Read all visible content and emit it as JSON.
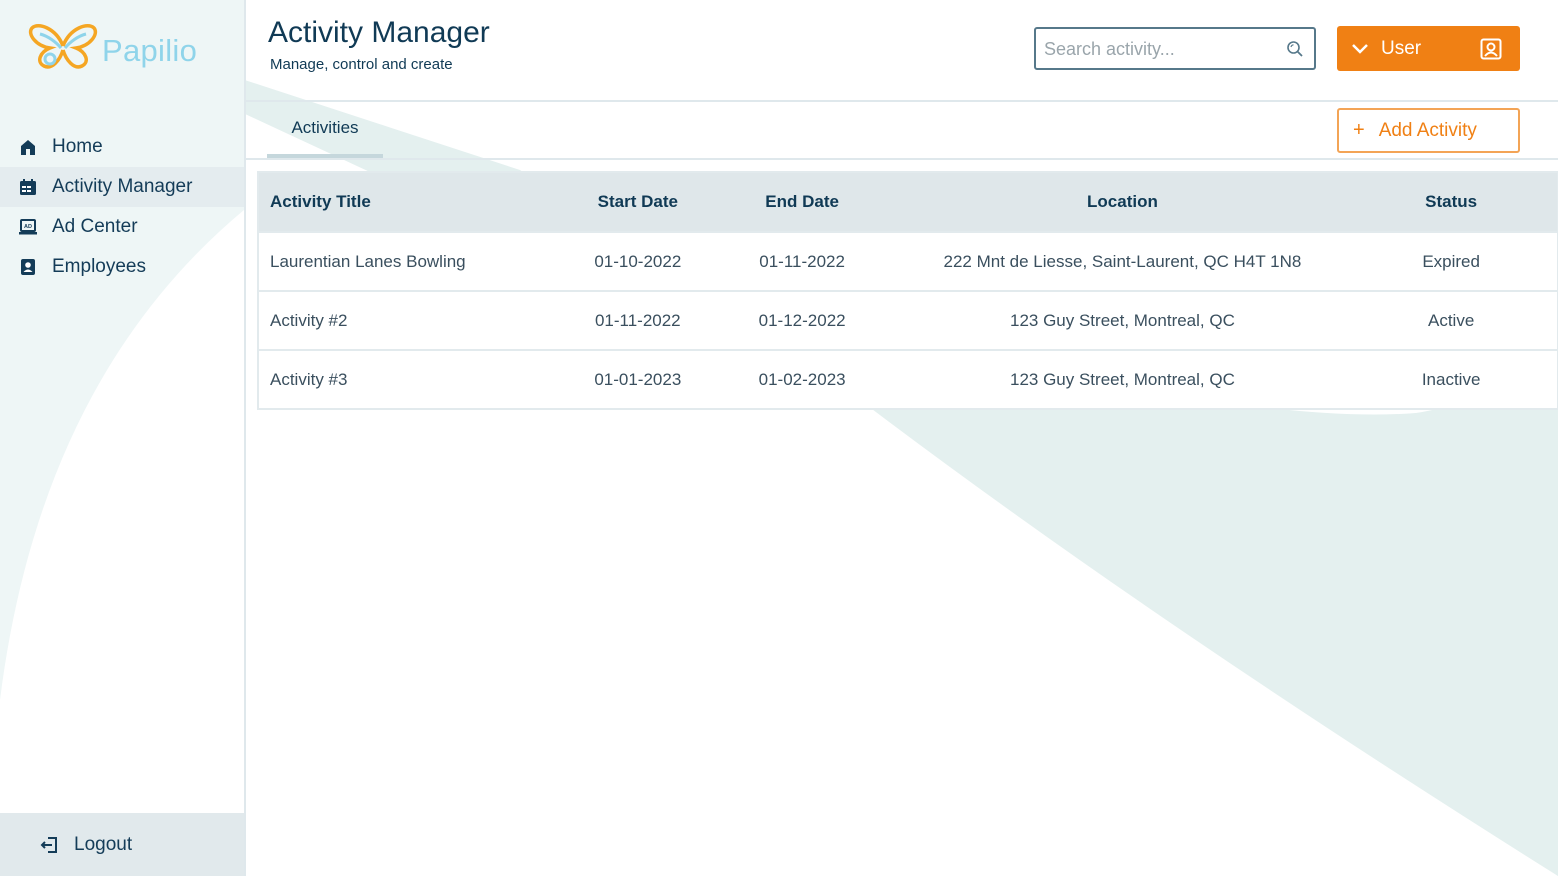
{
  "brand": {
    "name": "Papilio"
  },
  "sidebar": {
    "items": [
      {
        "label": "Home",
        "icon": "home-icon"
      },
      {
        "label": "Activity Manager",
        "icon": "calendar-icon",
        "active": true
      },
      {
        "label": "Ad Center",
        "icon": "ad-icon"
      },
      {
        "label": "Employees",
        "icon": "employee-badge-icon"
      }
    ],
    "logout_label": "Logout"
  },
  "header": {
    "title": "Activity Manager",
    "subtitle": "Manage, control and create",
    "search_placeholder": "Search activity...",
    "user_label": "User"
  },
  "tabs": [
    {
      "label": "Activities",
      "active": true
    }
  ],
  "actions": {
    "add_label": "Add Activity"
  },
  "table": {
    "columns": [
      "Activity Title",
      "Start Date",
      "End Date",
      "Location",
      "Status"
    ],
    "rows": [
      [
        "Laurentian Lanes Bowling",
        "01-10-2022",
        "01-11-2022",
        "222 Mnt de Liesse, Saint-Laurent, QC H4T 1N8",
        "Expired"
      ],
      [
        "Activity #2",
        "01-11-2022",
        "01-12-2022",
        "123 Guy Street, Montreal, QC",
        "Active"
      ],
      [
        "Activity #3",
        "01-01-2023",
        "01-02-2023",
        "123 Guy Street, Montreal, QC",
        "Inactive"
      ]
    ]
  },
  "colors": {
    "accent": "#f08014",
    "primary_text": "#103a55",
    "logo_text": "#8fd4ea",
    "background_wave": "#e3efee",
    "nav_active_bg": "#e4ecef"
  }
}
